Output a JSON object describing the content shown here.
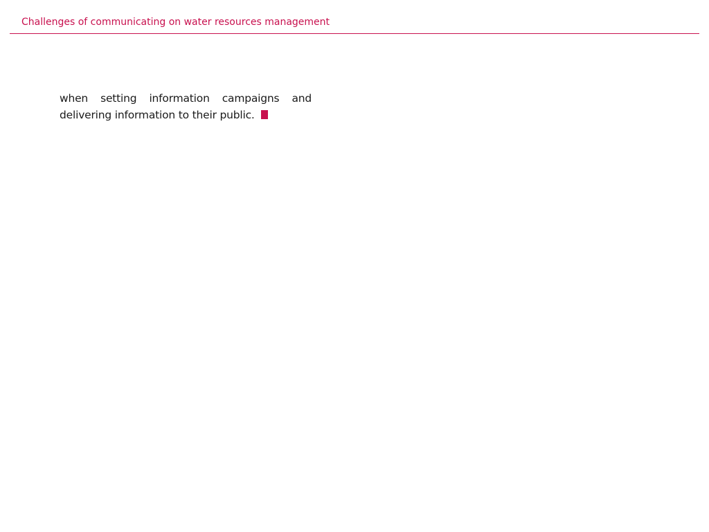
{
  "header": {
    "title": "Challenges of communicating on water resources management",
    "accent_color": "#c8104e"
  },
  "body": {
    "line1_words": [
      "when",
      "setting",
      "information",
      "campaigns",
      "and"
    ],
    "line2": "delivering information to their public."
  },
  "icons": {
    "end_mark": "end-of-article-square"
  }
}
